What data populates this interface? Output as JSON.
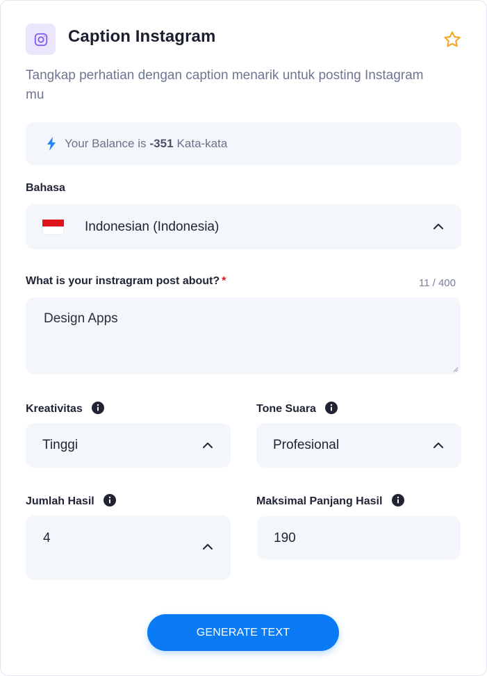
{
  "header": {
    "title": "Caption Instagram",
    "description": "Tangkap perhatian dengan caption menarik untuk posting Instagram mu",
    "app_icon": "instagram-icon",
    "favorite_icon": "star-outline-icon"
  },
  "balance": {
    "prefix": "Your Balance is",
    "amount": "-351",
    "unit": "Kata-kata",
    "icon": "lightning-bolt-icon"
  },
  "language": {
    "label": "Bahasa",
    "selected": "Indonesian (Indonesia)",
    "flag": "indonesia-flag"
  },
  "topic": {
    "label": "What is your instragram post about?",
    "required_mark": "*",
    "value": "Design Apps",
    "counter": "11 / 400"
  },
  "creativity": {
    "label": "Kreativitas",
    "selected": "Tinggi"
  },
  "tone": {
    "label": "Tone Suara",
    "selected": "Profesional"
  },
  "results": {
    "label": "Jumlah Hasil",
    "selected": "4"
  },
  "max_length": {
    "label": "Maksimal Panjang Hasil",
    "value": "190"
  },
  "actions": {
    "generate_label": "GENERATE TEXT"
  },
  "colors": {
    "accent": "#0a7bf5",
    "icon_bg": "#ebe6fb",
    "field_bg": "#f3f6fb",
    "star": "#f5a623",
    "required": "#e0141c"
  }
}
